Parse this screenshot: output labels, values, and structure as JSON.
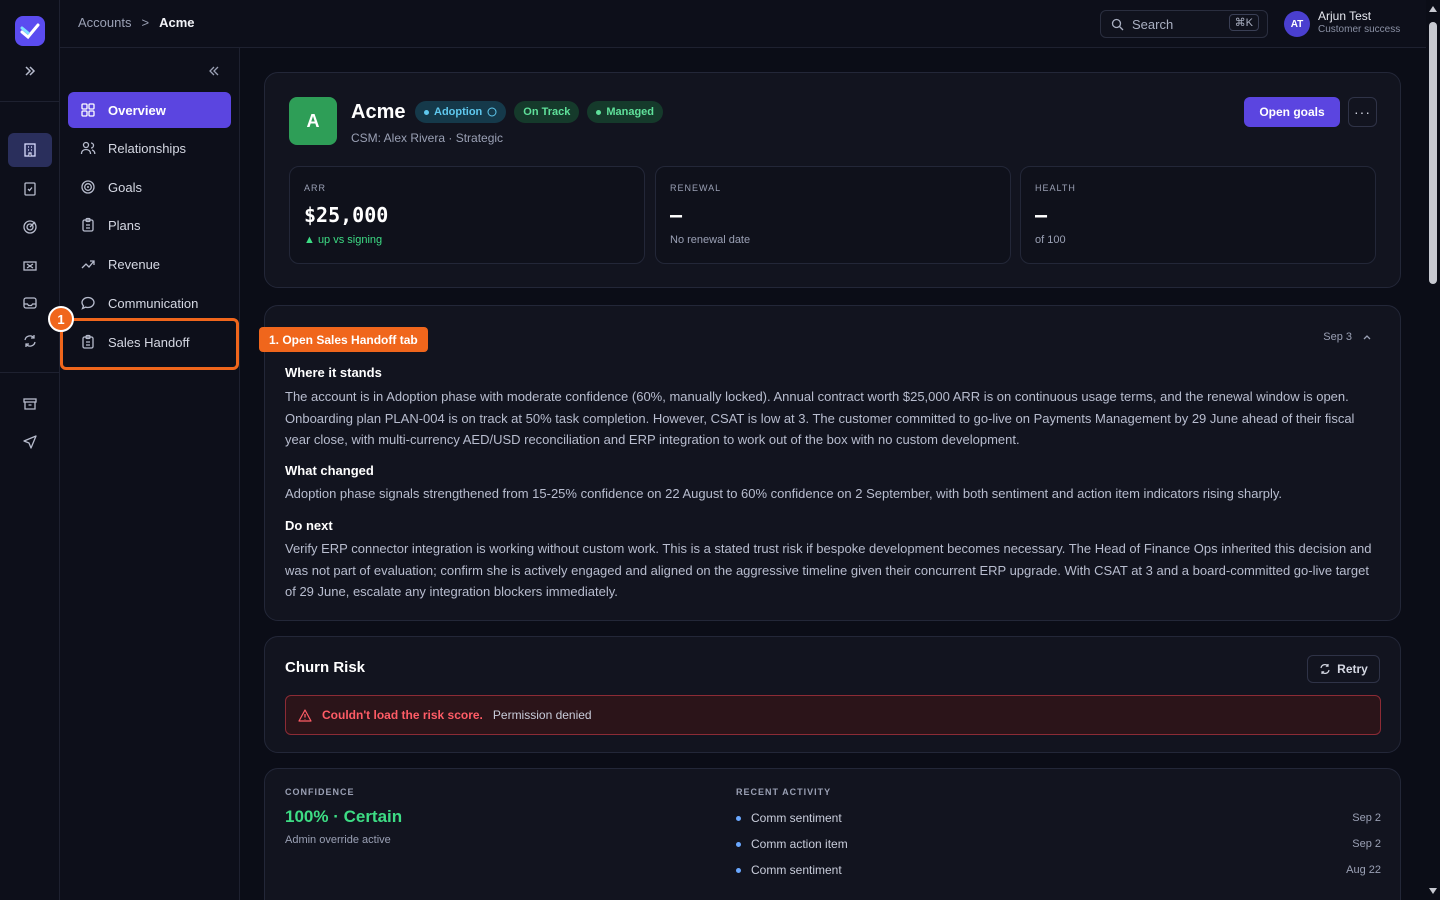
{
  "breadcrumb": {
    "root": "Accounts",
    "separator": ">",
    "current": "Acme"
  },
  "search": {
    "label": "Search",
    "shortcut": "⌘K"
  },
  "user": {
    "initials": "AT",
    "name": "Arjun Test",
    "role": "Customer success"
  },
  "nav": {
    "items": [
      {
        "label": "Overview",
        "icon": "grid-icon"
      },
      {
        "label": "Relationships",
        "icon": "users-icon"
      },
      {
        "label": "Goals",
        "icon": "target-icon"
      },
      {
        "label": "Plans",
        "icon": "clipboard-icon"
      },
      {
        "label": "Revenue",
        "icon": "trend-icon"
      },
      {
        "label": "Communication",
        "icon": "chat-icon"
      },
      {
        "label": "Sales Handoff",
        "icon": "clipboard-icon"
      }
    ]
  },
  "annotation": {
    "step": "1",
    "callout": "1. Open Sales Handoff tab"
  },
  "account": {
    "initial": "A",
    "name": "Acme",
    "pills": {
      "phase": "Adoption",
      "status": "On Track",
      "tier": "Managed"
    },
    "subtitle": "CSM: Alex Rivera · Strategic",
    "open_goals": "Open goals",
    "more": "···"
  },
  "metrics": [
    {
      "label": "ARR",
      "value": "$25,000",
      "foot": "▲ up vs signing"
    },
    {
      "label": "RENEWAL",
      "value": "—",
      "foot": "No renewal date"
    },
    {
      "label": "HEALTH",
      "value": "—",
      "foot": "of 100"
    }
  ],
  "summary": {
    "date": "Sep 3",
    "sections": [
      {
        "heading": "Where it stands",
        "body": "The account is in Adoption phase with moderate confidence (60%, manually locked). Annual contract worth $25,000 ARR is on continuous usage terms, and the renewal window is open. Onboarding plan PLAN-004 is on track at 50% task completion. However, CSAT is low at 3. The customer committed to go-live on Payments Management by 29 June ahead of their fiscal year close, with multi-currency AED/USD reconciliation and ERP integration to work out of the box with no custom development."
      },
      {
        "heading": "What changed",
        "body": "Adoption phase signals strengthened from 15-25% confidence on 22 August to 60% confidence on 2 September, with both sentiment and action item indicators rising sharply."
      },
      {
        "heading": "Do next",
        "body": "Verify ERP connector integration is working without custom work. This is a stated trust risk if bespoke development becomes necessary. The Head of Finance Ops inherited this decision and was not part of evaluation; confirm she is actively engaged and aligned on the aggressive timeline given their concurrent ERP upgrade. With CSAT at 3 and a board-committed go-live target of 29 June, escalate any integration blockers immediately."
      }
    ]
  },
  "churn": {
    "title": "Churn Risk",
    "retry": "Retry",
    "error_title": "Couldn't load the risk score.",
    "error_detail": "Permission denied"
  },
  "confidence": {
    "caption": "CONFIDENCE",
    "value": "100% · Certain",
    "note": "Admin override active"
  },
  "activity": {
    "caption": "RECENT ACTIVITY",
    "items": [
      {
        "label": "Comm sentiment",
        "date": "Sep  2"
      },
      {
        "label": "Comm action item",
        "date": "Sep  2"
      },
      {
        "label": "Comm sentiment",
        "date": "Aug  22"
      }
    ]
  }
}
